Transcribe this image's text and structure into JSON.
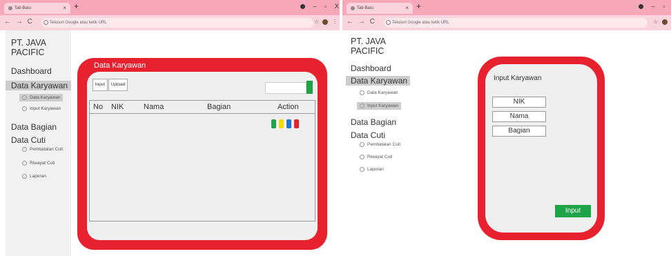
{
  "browser": {
    "tab_title": "Tab Baru",
    "tab_close": "×",
    "new_tab": "+",
    "omnibox_placeholder": "Telusuri Google atau ketik URL",
    "win_min": "–",
    "win_max": "▫",
    "win_close": "X",
    "back": "←",
    "forward": "→",
    "reload": "C",
    "star": "☆",
    "menu": "⋮"
  },
  "company": "PT. JAVA PACIFIC",
  "sidebar": {
    "dashboard": "Dashboard",
    "data_karyawan": "Data Karyawan",
    "data_karyawan_sub": [
      "Data Karyawan",
      "Input Karyawan"
    ],
    "data_bagian": "Data Bagian",
    "data_cuti": "Data Cuti",
    "data_cuti_sub": [
      "Pembatalan Cuti",
      "Riwayat Cuti",
      "Laporan"
    ]
  },
  "list_view": {
    "title": "Data Karyawan",
    "input_button": "Input",
    "upload_button": "Upload",
    "columns": [
      "No",
      "NIK",
      "Nama",
      "Bagian",
      "Action"
    ],
    "action_colors": [
      "#1ea447",
      "#f5d90a",
      "#1c74d4",
      "#e8212f"
    ]
  },
  "form_view": {
    "title": "Input Karyawan",
    "fields": [
      "NIK",
      "Nama",
      "Bagian"
    ],
    "submit": "Input"
  },
  "colors": {
    "accent_red": "#e8212f",
    "accent_green": "#1ea447",
    "tab_bar": "#f6a8b8"
  }
}
